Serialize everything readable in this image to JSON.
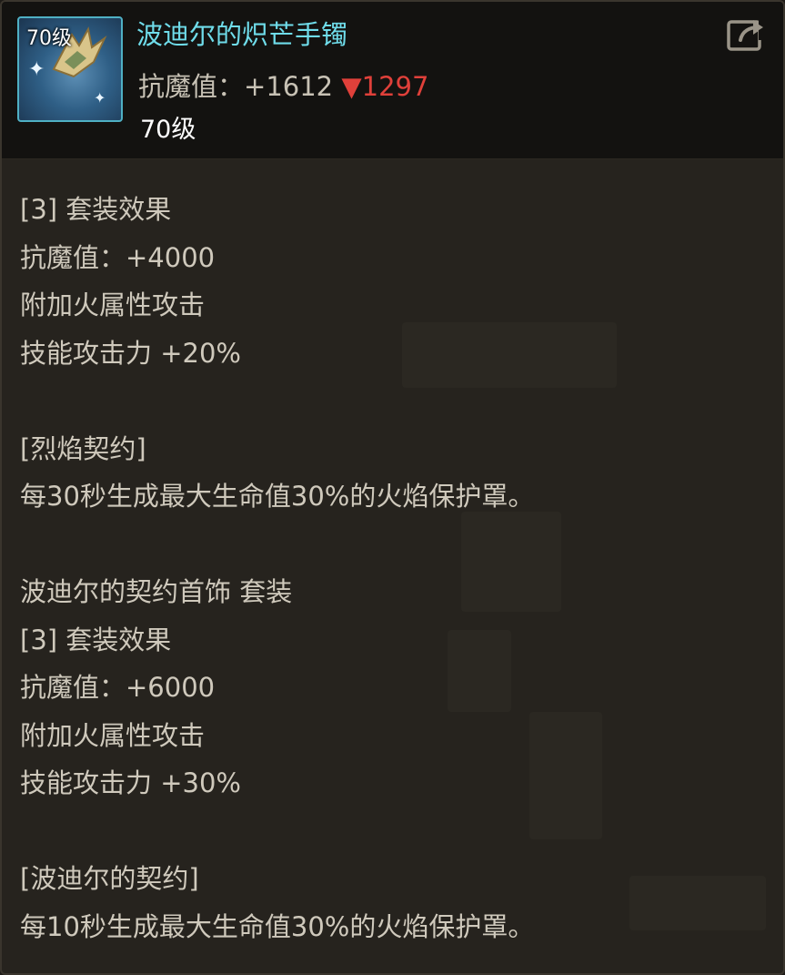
{
  "item": {
    "icon_level": "70级",
    "name": "波迪尔的炽芒手镯",
    "stat_label": "抗魔值：",
    "stat_value": "+1612",
    "stat_diff": "▼1297",
    "level": "70级"
  },
  "icons": {
    "item_icon": "bracelet-claw-icon",
    "share": "share-icon"
  },
  "colors": {
    "item_name": "#6fdcea",
    "diff_down": "#e0403a",
    "icon_border": "#4fb0c4"
  },
  "body": {
    "set1_effect_title": "[3] 套装效果",
    "set1_stat": "抗魔值：+4000",
    "set1_fire": "附加火属性攻击",
    "set1_skill": "技能攻击力 +20%",
    "pact1_name": "[烈焰契约]",
    "pact1_desc": "每30秒生成最大生命值30%的火焰保护罩。",
    "set2_name": "波迪尔的契约首饰 套装",
    "set2_effect_title": "[3] 套装效果",
    "set2_stat": "抗魔值：+6000",
    "set2_fire": "附加火属性攻击",
    "set2_skill": "技能攻击力 +30%",
    "pact2_name": "[波迪尔的契约]",
    "pact2_desc": "每10秒生成最大生命值30%的火焰保护罩。"
  }
}
